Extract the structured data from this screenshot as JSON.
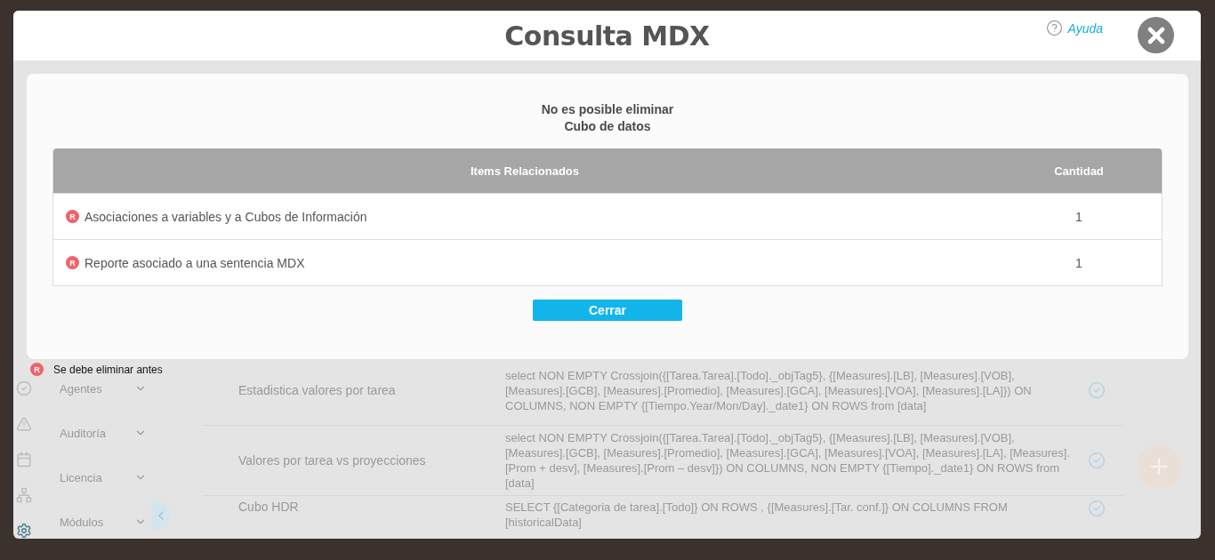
{
  "dialog": {
    "title": "Consulta MDX",
    "help_link": "Ayuda"
  },
  "alert": {
    "heading_lines": [
      "No es posible eliminar",
      "Cubo de datos"
    ],
    "columns": [
      "Items Relacionados",
      "Cantidad"
    ],
    "rows": [
      {
        "badge": "R",
        "item": "Asociaciones a variables y a Cubos de Información",
        "count": "1"
      },
      {
        "badge": "R",
        "item": "Reporte asociado a una sentencia MDX",
        "count": "1"
      }
    ],
    "button": "Cerrar"
  },
  "legend": {
    "badge": "R",
    "text": "Se debe eliminar antes"
  },
  "background": {
    "sidebar_items": [
      "Agentes",
      "Auditoría",
      "Licencia",
      "Módulos"
    ],
    "rows": [
      {
        "name": "Estadistica valores por tarea",
        "query": "select NON EMPTY Crossjoin({[Tarea.Tarea].[Todo]._objTag5}, {[Measures].[LB], [Measures].[VOB], [Measures].[GCB], [Measures].[Promedio], [Measures].[GCA], [Measures].[VOA], [Measures].[LA]}) ON COLUMNS, NON EMPTY {[Tiempo.Year/Mon/Day]._date1} ON ROWS from [data]"
      },
      {
        "name": "Valores por tarea vs proyecciones",
        "query": "select NON EMPTY Crossjoin({[Tarea.Tarea].[Todo]._objTag5}, {[Measures].[LB], [Measures].[VOB], [Measures].[GCB], [Measures].[Promedio], [Measures].[GCA], [Measures].[VOA], [Measures].[LA], [Measures].[Prom + desv], [Measures].[Prom – desv]}) ON COLUMNS, NON EMPTY {[Tiempo]._date1} ON ROWS from [data]"
      },
      {
        "name": "Cubo HDR",
        "query": "SELECT {[Categoria de tarea].[Todo]} ON ROWS , {[Measures].[Tar. conf.]} ON COLUMNS FROM [historicalData]"
      }
    ]
  }
}
